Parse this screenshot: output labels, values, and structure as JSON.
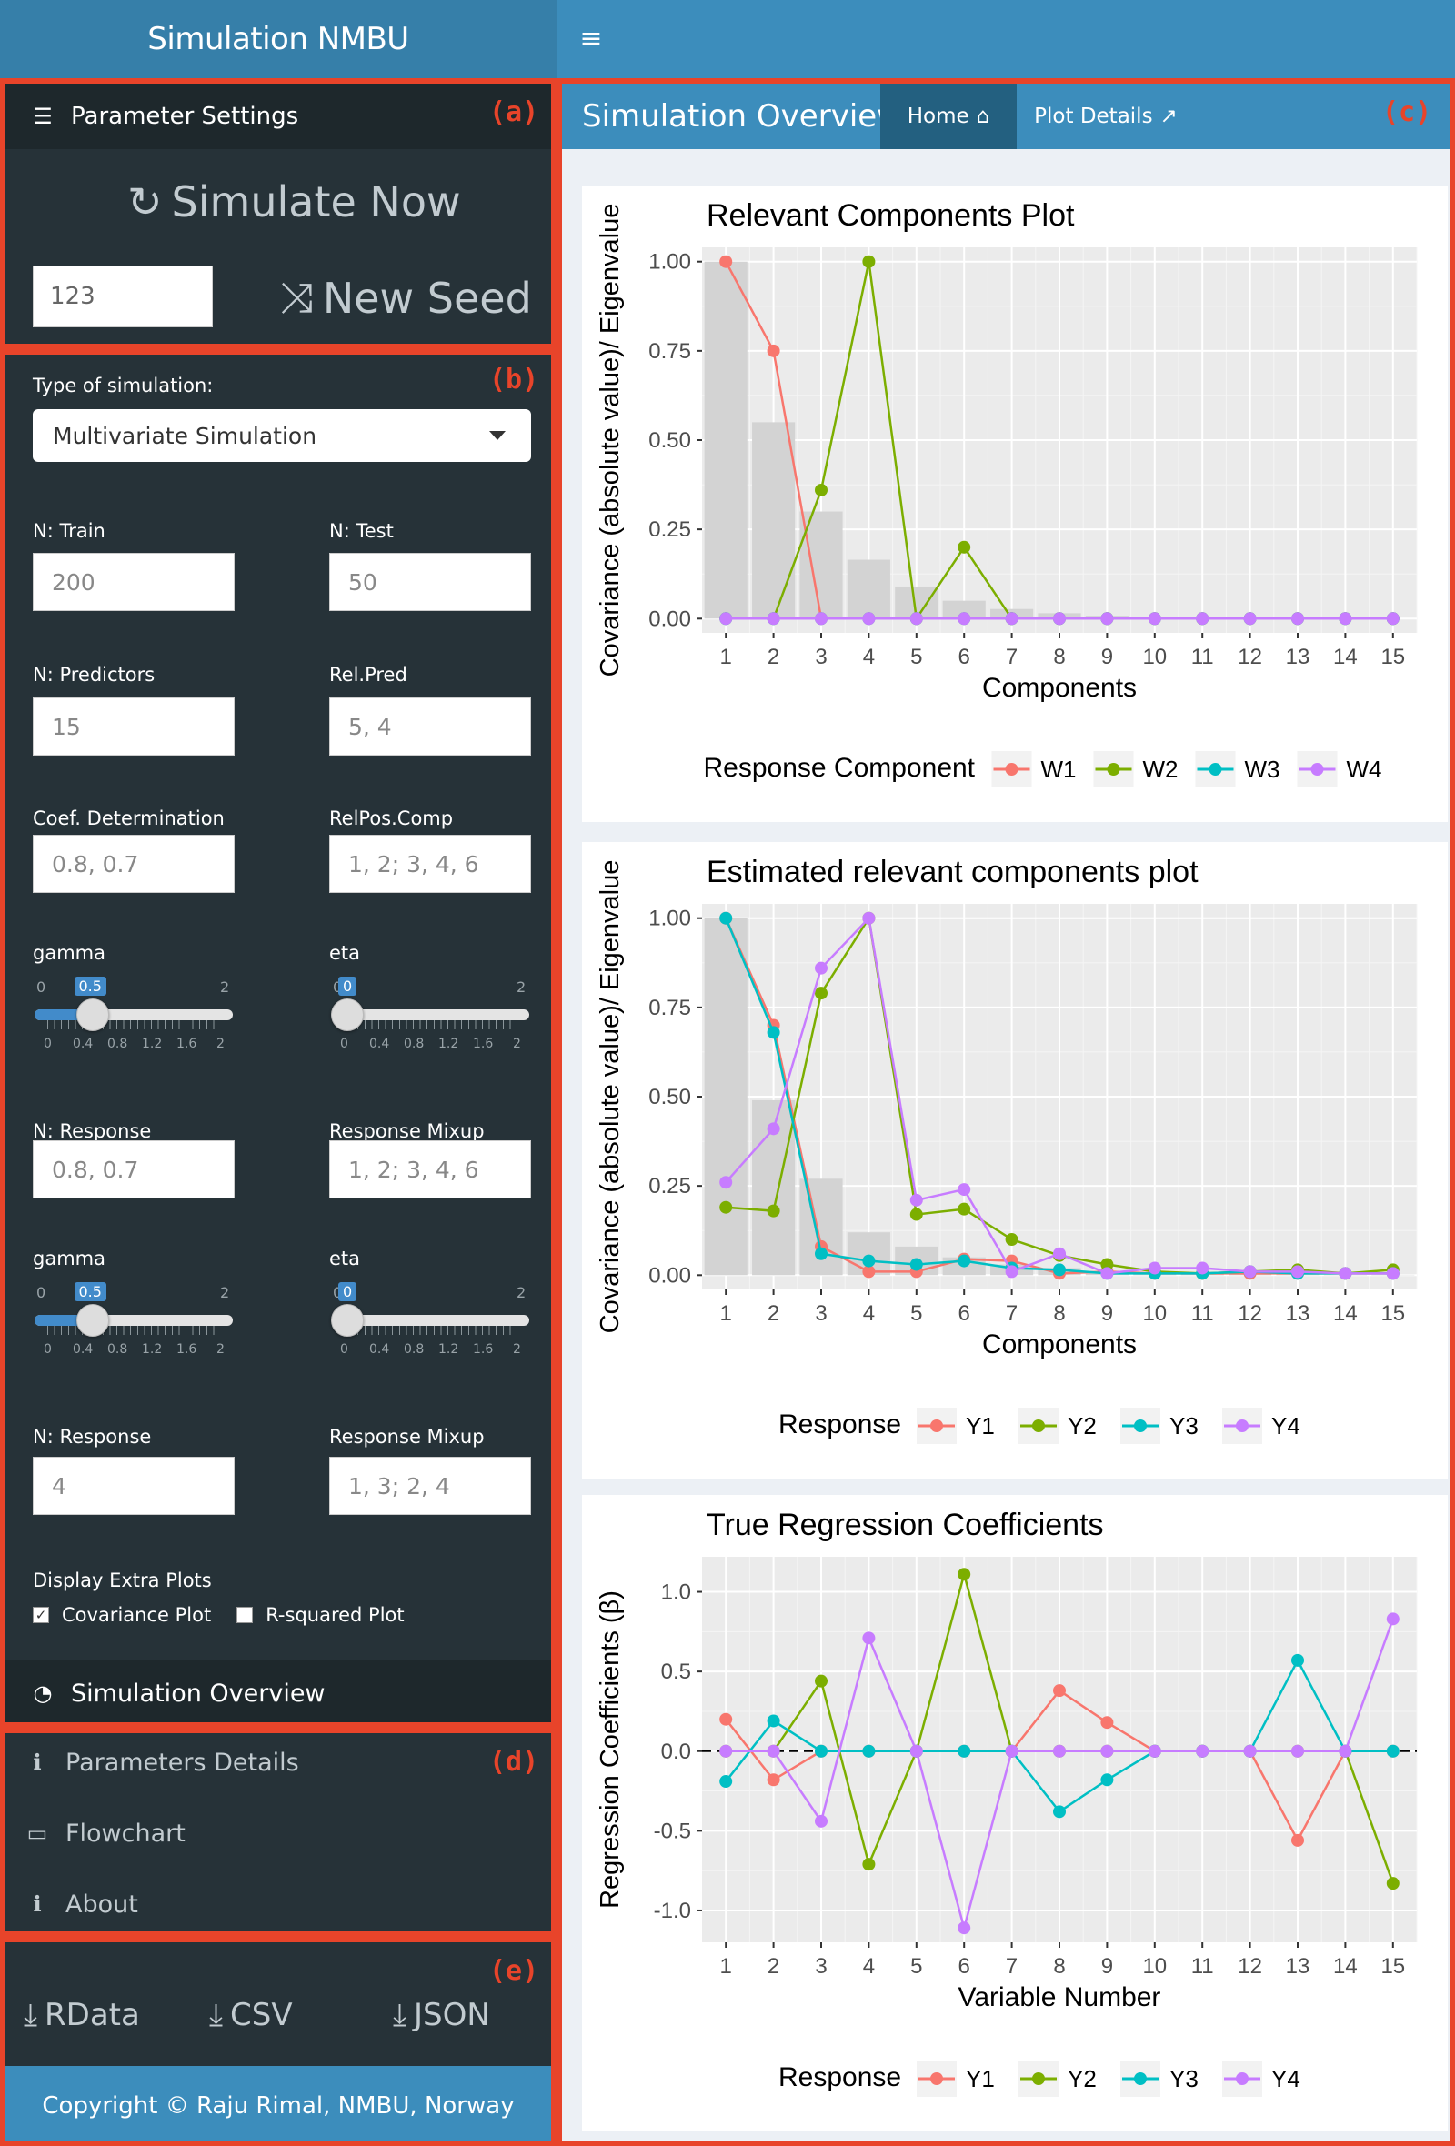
{
  "app": {
    "title": "Simulation NMBU"
  },
  "sections": {
    "a": "(a)",
    "b": "(b)",
    "c": "(c)",
    "d": "(d)",
    "e": "(e)"
  },
  "sidebar": {
    "param_header": "Parameter Settings",
    "simulate_label": "Simulate Now",
    "seed_value": "123",
    "new_seed_label": "New Seed",
    "sim_type_label": "Type of simulation:",
    "sim_type_value": "Multivariate Simulation",
    "fields": {
      "ntrain": {
        "label": "N: Train",
        "value": "200"
      },
      "ntest": {
        "label": "N: Test",
        "value": "50"
      },
      "npred": {
        "label": "N: Predictors",
        "value": "15"
      },
      "relpred": {
        "label": "Rel.Pred",
        "value": "5, 4"
      },
      "coef": {
        "label": "Coef. Determination",
        "value": "0.8, 0.7"
      },
      "relpos": {
        "label": "RelPos.Comp",
        "value": "1, 2; 3, 4, 6"
      },
      "nresp1": {
        "label": "N: Response",
        "value": "0.8, 0.7"
      },
      "mixup1": {
        "label": "Response Mixup",
        "value": "1, 2; 3, 4, 6"
      },
      "nresp2": {
        "label": "N: Response",
        "value": "4"
      },
      "mixup2": {
        "label": "Response Mixup",
        "value": "1, 3; 2, 4"
      }
    },
    "sliders": [
      {
        "label": "gamma",
        "min": "0",
        "max": "2",
        "value": "0.5",
        "value_frac": 0.25
      },
      {
        "label": "eta",
        "min": "0",
        "max": "2",
        "value": "0",
        "value_frac": 0
      },
      {
        "label": "gamma",
        "min": "0",
        "max": "2",
        "value": "0.5",
        "value_frac": 0.25
      },
      {
        "label": "eta",
        "min": "0",
        "max": "2",
        "value": "0",
        "value_frac": 0
      }
    ],
    "slider_ticks": [
      "0",
      "0.4",
      "0.8",
      "1.2",
      "1.6",
      "2"
    ],
    "extra_label": "Display Extra Plots",
    "cov_plot_label": "Covariance Plot",
    "cov_checked": true,
    "r2_plot_label": "R-squared Plot",
    "r2_checked": false,
    "overview_label": "Simulation Overview",
    "menu": [
      "Parameters Details",
      "Flowchart",
      "About"
    ],
    "downloads": [
      "RData",
      "CSV",
      "JSON"
    ],
    "footer": "Copyright © Raju Rimal, NMBU, Norway"
  },
  "main": {
    "title": "Simulation Overview",
    "tabs": [
      "Home",
      "Plot Details"
    ]
  },
  "colors": {
    "W1": "#F8766D",
    "W2": "#7CAE00",
    "W3": "#00BFC4",
    "W4": "#C77CFF",
    "header": "#3c8dbc",
    "sidebar": "#263238",
    "red": "#e8442a"
  },
  "chart_data": [
    {
      "type": "line",
      "title": "Relevant Components Plot",
      "xlabel": "Components",
      "ylabel": "Covariance (absolute value)/ Eigenvalue",
      "x": [
        1,
        2,
        3,
        4,
        5,
        6,
        7,
        8,
        9,
        10,
        11,
        12,
        13,
        14,
        15
      ],
      "ylim": [
        -0.04,
        1.04
      ],
      "yticks": [
        "0.00",
        "0.25",
        "0.50",
        "0.75",
        "1.00"
      ],
      "bars": [
        1.0,
        0.55,
        0.3,
        0.165,
        0.09,
        0.05,
        0.027,
        0.015,
        0.008,
        0.004,
        0.002,
        0.001,
        0.0005,
        0.0003,
        0.0001
      ],
      "legend_title": "Response Component",
      "series": [
        {
          "name": "W1",
          "values": [
            1.0,
            0.75,
            0,
            0,
            0,
            0,
            0,
            0,
            0,
            0,
            0,
            0,
            0,
            0,
            0
          ]
        },
        {
          "name": "W2",
          "values": [
            0,
            0,
            0.36,
            1.0,
            0,
            0.2,
            0,
            0,
            0,
            0,
            0,
            0,
            0,
            0,
            0
          ]
        },
        {
          "name": "W3",
          "values": [
            0,
            0,
            0,
            0,
            0,
            0,
            0,
            0,
            0,
            0,
            0,
            0,
            0,
            0,
            0
          ]
        },
        {
          "name": "W4",
          "values": [
            0,
            0,
            0,
            0,
            0,
            0,
            0,
            0,
            0,
            0,
            0,
            0,
            0,
            0,
            0
          ]
        }
      ]
    },
    {
      "type": "line",
      "title": "Estimated relevant components plot",
      "xlabel": "Components",
      "ylabel": "Covariance (absolute value)/ Eigenvalue",
      "x": [
        1,
        2,
        3,
        4,
        5,
        6,
        7,
        8,
        9,
        10,
        11,
        12,
        13,
        14,
        15
      ],
      "ylim": [
        -0.04,
        1.04
      ],
      "yticks": [
        "0.00",
        "0.25",
        "0.50",
        "0.75",
        "1.00"
      ],
      "bars": [
        1.0,
        0.49,
        0.27,
        0.12,
        0.08,
        0.05,
        0.03,
        0.02,
        0.01,
        0.006,
        0.004,
        0.003,
        0.002,
        0.001,
        0.001
      ],
      "legend_title": "Response",
      "series": [
        {
          "name": "Y1",
          "values": [
            1.0,
            0.7,
            0.08,
            0.01,
            0.01,
            0.045,
            0.04,
            0.005,
            0.01,
            0.005,
            0.005,
            0.005,
            0.005,
            0.005,
            0.005
          ]
        },
        {
          "name": "Y2",
          "values": [
            0.19,
            0.18,
            0.79,
            1.0,
            0.17,
            0.185,
            0.1,
            0.055,
            0.03,
            0.01,
            0.005,
            0.01,
            0.015,
            0.005,
            0.015
          ]
        },
        {
          "name": "Y3",
          "values": [
            1.0,
            0.68,
            0.06,
            0.04,
            0.03,
            0.04,
            0.02,
            0.015,
            0.005,
            0.005,
            0.005,
            0.01,
            0.005,
            0.005,
            0.005
          ]
        },
        {
          "name": "Y4",
          "values": [
            0.26,
            0.41,
            0.86,
            1.0,
            0.21,
            0.24,
            0.01,
            0.06,
            0.005,
            0.02,
            0.02,
            0.01,
            0.01,
            0.005,
            0.005
          ]
        }
      ]
    },
    {
      "type": "line",
      "title": "True Regression Coefficients",
      "xlabel": "Variable Number",
      "ylabel": "Regression Coefficients (β)",
      "x": [
        1,
        2,
        3,
        4,
        5,
        6,
        7,
        8,
        9,
        10,
        11,
        12,
        13,
        14,
        15
      ],
      "ylim": [
        -1.2,
        1.22
      ],
      "yticks": [
        "-1.0",
        "-0.5",
        "0.0",
        "0.5",
        "1.0"
      ],
      "legend_title": "Response",
      "series": [
        {
          "name": "Y1",
          "values": [
            0.2,
            -0.18,
            0,
            0,
            0,
            0,
            0,
            0.38,
            0.18,
            0,
            0,
            0,
            -0.56,
            0,
            0
          ]
        },
        {
          "name": "Y2",
          "values": [
            0,
            0,
            0.44,
            -0.71,
            0,
            1.11,
            0,
            0,
            0,
            0,
            0,
            0,
            0,
            0,
            -0.83
          ]
        },
        {
          "name": "Y3",
          "values": [
            -0.19,
            0.19,
            0,
            0,
            0,
            0,
            0,
            -0.38,
            -0.18,
            0,
            0,
            0,
            0.57,
            0,
            0
          ]
        },
        {
          "name": "Y4",
          "values": [
            0,
            0,
            -0.44,
            0.71,
            0,
            -1.11,
            0,
            0,
            0,
            0,
            0,
            0,
            0,
            0,
            0.83
          ]
        }
      ]
    }
  ]
}
